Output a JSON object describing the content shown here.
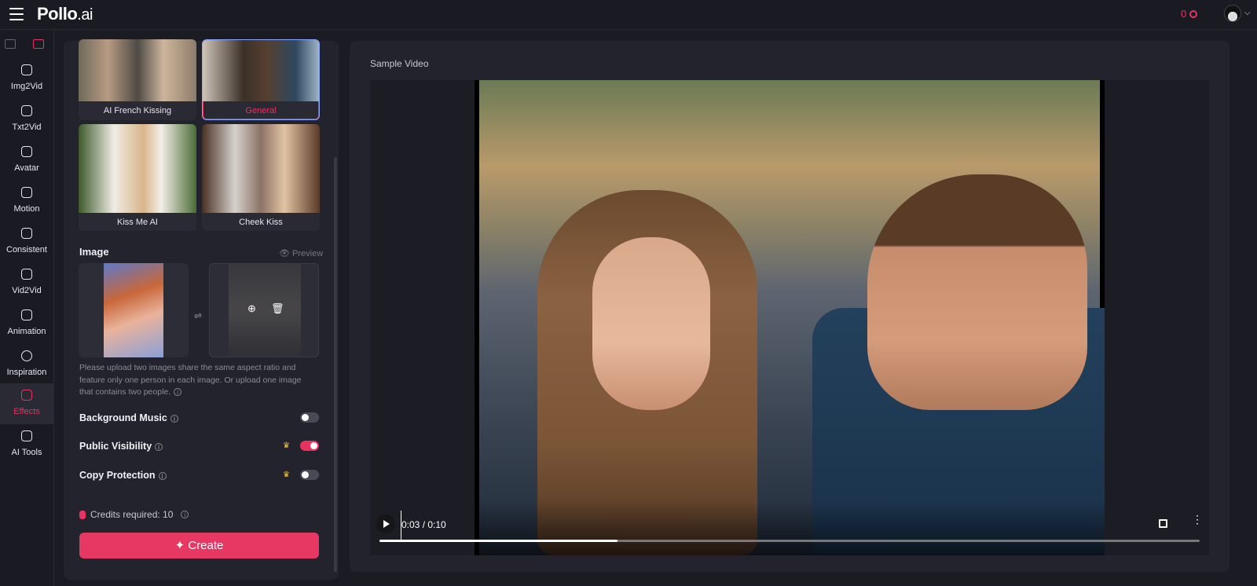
{
  "app": {
    "logo_main": "Pollo",
    "logo_suffix": ".ai",
    "credits": "0"
  },
  "sidebar": {
    "items": [
      {
        "label": "Img2Vid"
      },
      {
        "label": "Txt2Vid"
      },
      {
        "label": "Avatar"
      },
      {
        "label": "Motion"
      },
      {
        "label": "Consistent"
      },
      {
        "label": "Vid2Vid"
      },
      {
        "label": "Animation"
      },
      {
        "label": "Inspiration"
      },
      {
        "label": "Effects"
      },
      {
        "label": "AI Tools"
      }
    ],
    "active": "Effects"
  },
  "effects": {
    "cards": [
      {
        "name": "AI French Kissing"
      },
      {
        "name": "General",
        "selected": true
      },
      {
        "name": "Kiss Me AI"
      },
      {
        "name": "Cheek Kiss"
      }
    ]
  },
  "image_section": {
    "title": "Image",
    "preview": "Preview",
    "hint": "Please upload two images share the same aspect ratio and feature only one person in each image. Or upload one image that contains two people."
  },
  "settings": {
    "background_music": {
      "label": "Background Music",
      "on": false
    },
    "public_visibility": {
      "label": "Public Visibility",
      "on": true
    },
    "copy_protection": {
      "label": "Copy Protection",
      "on": false
    }
  },
  "credits_required": "Credits required: 10",
  "create_label": "Create",
  "player": {
    "section_label": "Sample Video",
    "time": "0:03 / 0:10",
    "progress": 0.29
  },
  "colors": {
    "accent": "#e8325f",
    "background": "#1b1b24",
    "panel": "#23232d"
  }
}
